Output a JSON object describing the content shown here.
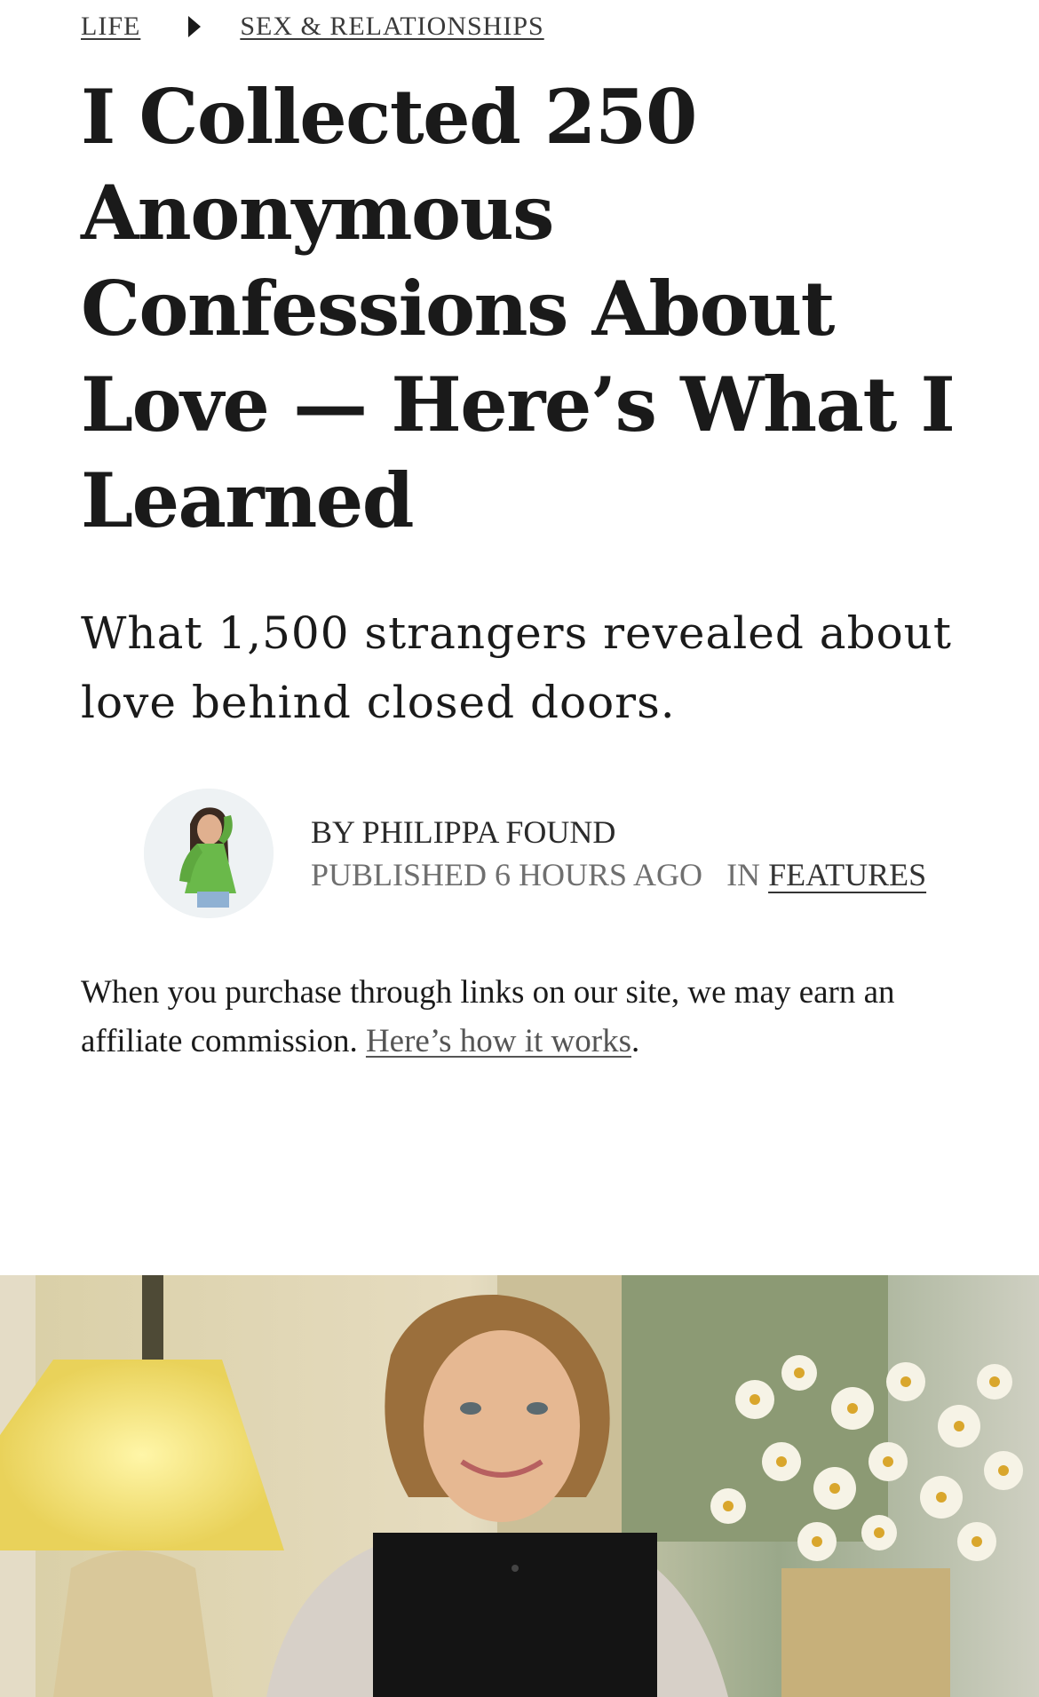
{
  "breadcrumb": {
    "first": "LIFE",
    "second": "SEX & RELATIONSHIPS"
  },
  "article": {
    "title": "I Collected 250 Anonymous Confessions About Love — Here’s What I Learned",
    "subtitle": "What 1,500 strangers revealed about love behind closed doors."
  },
  "byline": {
    "author": "BY PHILIPPA FOUND",
    "published": "PUBLISHED 6 HOURS AGO",
    "in_label": "IN",
    "section": "FEATURES"
  },
  "affiliate": {
    "text": "When you purchase through links on our site, we may earn an affiliate commission.",
    "link": "Here’s how it works",
    "end": "."
  },
  "icons": {
    "breadcrumb_separator": "caret-right-icon"
  },
  "colors": {
    "text": "#1a1a1a",
    "muted": "#6f6f6f",
    "background": "#ffffff"
  }
}
